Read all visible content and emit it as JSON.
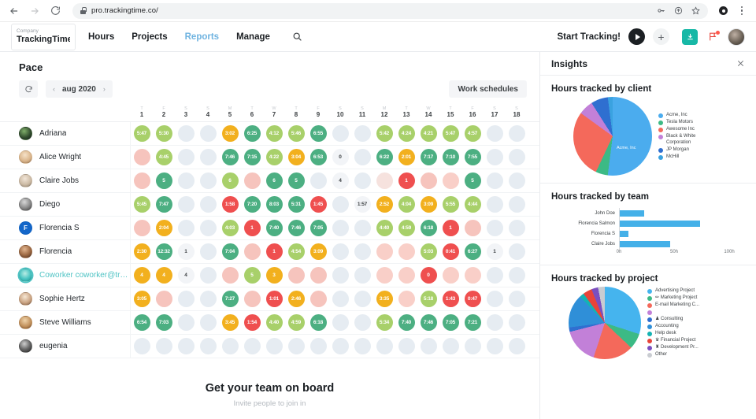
{
  "browser": {
    "url": "pro.trackingtime.co/",
    "back_icon": "back-arrow-icon",
    "forward_icon": "forward-arrow-icon",
    "reload_icon": "reload-icon"
  },
  "header": {
    "company_label": "Company",
    "company_name": "TrackingTime...",
    "nav": [
      {
        "label": "Hours",
        "active": false
      },
      {
        "label": "Projects",
        "active": false
      },
      {
        "label": "Reports",
        "active": true
      },
      {
        "label": "Manage",
        "active": false
      }
    ],
    "start_tracking": "Start Tracking!",
    "plus_label": "+"
  },
  "pace": {
    "title": "Pace",
    "month": "aug 2020",
    "prev": "‹",
    "next": "›",
    "work_schedules": "Work schedules"
  },
  "grid": {
    "days": [
      {
        "dow": "T",
        "num": "1"
      },
      {
        "dow": "F",
        "num": "2"
      },
      {
        "dow": "S",
        "num": "3"
      },
      {
        "dow": "S",
        "num": "4"
      },
      {
        "dow": "M",
        "num": "5"
      },
      {
        "dow": "T",
        "num": "6"
      },
      {
        "dow": "W",
        "num": "7"
      },
      {
        "dow": "T",
        "num": "8"
      },
      {
        "dow": "F",
        "num": "9"
      },
      {
        "dow": "S",
        "num": "10"
      },
      {
        "dow": "S",
        "num": "11"
      },
      {
        "dow": "M",
        "num": "12"
      },
      {
        "dow": "T",
        "num": "13"
      },
      {
        "dow": "W",
        "num": "14"
      },
      {
        "dow": "T",
        "num": "15"
      },
      {
        "dow": "F",
        "num": "16"
      },
      {
        "dow": "S",
        "num": "17"
      },
      {
        "dow": "S",
        "num": "18"
      }
    ],
    "rows": [
      {
        "name": "Adriana",
        "avatar": "photo-dark",
        "highlight": false,
        "cells": [
          {
            "v": "5:47",
            "c": "#a8d06a"
          },
          {
            "v": "5:30",
            "c": "#a8d06a"
          },
          {
            "v": "",
            "c": "empty"
          },
          {
            "v": "",
            "c": "empty"
          },
          {
            "v": "3:02",
            "c": "#f2b01e"
          },
          {
            "v": "6:25",
            "c": "#4caf82"
          },
          {
            "v": "4:12",
            "c": "#a8d06a"
          },
          {
            "v": "5:46",
            "c": "#a8d06a"
          },
          {
            "v": "6:55",
            "c": "#4caf82"
          },
          {
            "v": "",
            "c": "empty"
          },
          {
            "v": "",
            "c": "empty"
          },
          {
            "v": "5:42",
            "c": "#a8d06a"
          },
          {
            "v": "4:24",
            "c": "#a8d06a"
          },
          {
            "v": "4:21",
            "c": "#a8d06a"
          },
          {
            "v": "5:47",
            "c": "#a8d06a"
          },
          {
            "v": "4:57",
            "c": "#a8d06a"
          },
          {
            "v": "",
            "c": "empty"
          },
          {
            "v": "",
            "c": "empty"
          }
        ]
      },
      {
        "name": "Alice Wright",
        "avatar": "photo-light",
        "highlight": false,
        "cells": [
          {
            "v": "",
            "c": "#f6c4bd"
          },
          {
            "v": "4:45",
            "c": "#a8d06a"
          },
          {
            "v": "",
            "c": "empty"
          },
          {
            "v": "",
            "c": "empty"
          },
          {
            "v": "7:46",
            "c": "#4caf82"
          },
          {
            "v": "7:15",
            "c": "#4caf82"
          },
          {
            "v": "4:22",
            "c": "#a8d06a"
          },
          {
            "v": "3:04",
            "c": "#f2b01e"
          },
          {
            "v": "6:53",
            "c": "#4caf82"
          },
          {
            "v": "0",
            "c": "white"
          },
          {
            "v": "",
            "c": "empty"
          },
          {
            "v": "6:22",
            "c": "#4caf82"
          },
          {
            "v": "2:01",
            "c": "#f2b01e"
          },
          {
            "v": "7:17",
            "c": "#4caf82"
          },
          {
            "v": "7:10",
            "c": "#4caf82"
          },
          {
            "v": "7:55",
            "c": "#4caf82"
          },
          {
            "v": "",
            "c": "empty"
          },
          {
            "v": "",
            "c": "empty"
          }
        ]
      },
      {
        "name": "Claire Jobs",
        "avatar": "photo-light2",
        "highlight": false,
        "cells": [
          {
            "v": "",
            "c": "#f6c4bd"
          },
          {
            "v": "5",
            "c": "#4caf82"
          },
          {
            "v": "",
            "c": "empty"
          },
          {
            "v": "",
            "c": "empty"
          },
          {
            "v": "6",
            "c": "#a8d06a"
          },
          {
            "v": "",
            "c": "#f6c4bd"
          },
          {
            "v": "6",
            "c": "#4caf82"
          },
          {
            "v": "5",
            "c": "#4caf82"
          },
          {
            "v": "",
            "c": "empty"
          },
          {
            "v": "4",
            "c": "white"
          },
          {
            "v": "",
            "c": "empty"
          },
          {
            "v": "",
            "c": "#f6e2de"
          },
          {
            "v": "1",
            "c": "#ef4f4f"
          },
          {
            "v": "",
            "c": "#f6c4bd"
          },
          {
            "v": "",
            "c": "#f9cfc8"
          },
          {
            "v": "5",
            "c": "#4caf82"
          },
          {
            "v": "",
            "c": "empty"
          },
          {
            "v": "",
            "c": "empty"
          }
        ]
      },
      {
        "name": "Diego",
        "avatar": "photo-grey",
        "highlight": false,
        "cells": [
          {
            "v": "5:45",
            "c": "#a8d06a"
          },
          {
            "v": "7:47",
            "c": "#4caf82"
          },
          {
            "v": "",
            "c": "empty"
          },
          {
            "v": "",
            "c": "empty"
          },
          {
            "v": "1:58",
            "c": "#ef4f4f"
          },
          {
            "v": "7:20",
            "c": "#4caf82"
          },
          {
            "v": "8:03",
            "c": "#4caf82"
          },
          {
            "v": "5:31",
            "c": "#4caf82"
          },
          {
            "v": "1:45",
            "c": "#ef4f4f"
          },
          {
            "v": "",
            "c": "empty"
          },
          {
            "v": "1:57",
            "c": "white"
          },
          {
            "v": "2:52",
            "c": "#f2b01e"
          },
          {
            "v": "4:04",
            "c": "#a8d06a"
          },
          {
            "v": "3:09",
            "c": "#f2b01e"
          },
          {
            "v": "5:55",
            "c": "#a8d06a"
          },
          {
            "v": "4:44",
            "c": "#a8d06a"
          },
          {
            "v": "",
            "c": "empty"
          },
          {
            "v": "",
            "c": "empty"
          }
        ]
      },
      {
        "name": "Florencia S",
        "avatar": "initial-F",
        "highlight": false,
        "cells": [
          {
            "v": "",
            "c": "#f6c4bd"
          },
          {
            "v": "2:04",
            "c": "#f2b01e"
          },
          {
            "v": "",
            "c": "empty"
          },
          {
            "v": "",
            "c": "empty"
          },
          {
            "v": "4:03",
            "c": "#a8d06a"
          },
          {
            "v": "1",
            "c": "#ef4f4f"
          },
          {
            "v": "7:40",
            "c": "#4caf82"
          },
          {
            "v": "7:46",
            "c": "#4caf82"
          },
          {
            "v": "7:05",
            "c": "#4caf82"
          },
          {
            "v": "",
            "c": "empty"
          },
          {
            "v": "",
            "c": "empty"
          },
          {
            "v": "4:40",
            "c": "#a8d06a"
          },
          {
            "v": "4:59",
            "c": "#a8d06a"
          },
          {
            "v": "6:18",
            "c": "#4caf82"
          },
          {
            "v": "1",
            "c": "#ef4f4f"
          },
          {
            "v": "",
            "c": "#f6c4bd"
          },
          {
            "v": "",
            "c": "empty"
          },
          {
            "v": "",
            "c": "empty"
          }
        ]
      },
      {
        "name": "Florencia",
        "avatar": "photo-brown",
        "highlight": false,
        "cells": [
          {
            "v": "2:30",
            "c": "#f2b01e"
          },
          {
            "v": "12:32",
            "c": "#4caf82"
          },
          {
            "v": "1",
            "c": "white"
          },
          {
            "v": "",
            "c": "empty"
          },
          {
            "v": "7:04",
            "c": "#4caf82"
          },
          {
            "v": "",
            "c": "#f6c4bd"
          },
          {
            "v": "1",
            "c": "#ef4f4f"
          },
          {
            "v": "4:54",
            "c": "#a8d06a"
          },
          {
            "v": "3:09",
            "c": "#f2b01e"
          },
          {
            "v": "",
            "c": "empty"
          },
          {
            "v": "",
            "c": "empty"
          },
          {
            "v": "",
            "c": "#f9cfc8"
          },
          {
            "v": "",
            "c": "#f9cfc8"
          },
          {
            "v": "5:03",
            "c": "#a8d06a"
          },
          {
            "v": "0:41",
            "c": "#ef4f4f"
          },
          {
            "v": "6:27",
            "c": "#4caf82"
          },
          {
            "v": "1",
            "c": "white"
          },
          {
            "v": "",
            "c": "empty"
          }
        ]
      },
      {
        "name": "Coworker coworker@trac...",
        "avatar": "photo-teal",
        "highlight": true,
        "cells": [
          {
            "v": "4",
            "c": "#f2b01e"
          },
          {
            "v": "4",
            "c": "#f2b01e"
          },
          {
            "v": "4",
            "c": "white"
          },
          {
            "v": "",
            "c": "empty"
          },
          {
            "v": "",
            "c": "#f6c4bd"
          },
          {
            "v": "5",
            "c": "#a8d06a"
          },
          {
            "v": "3",
            "c": "#f2b01e"
          },
          {
            "v": "",
            "c": "#f6c4bd"
          },
          {
            "v": "",
            "c": "#f6c4bd"
          },
          {
            "v": "",
            "c": "empty"
          },
          {
            "v": "",
            "c": "empty"
          },
          {
            "v": "",
            "c": "#f9cfc8"
          },
          {
            "v": "",
            "c": "#f9cfc8"
          },
          {
            "v": "0",
            "c": "#ef4f4f"
          },
          {
            "v": "",
            "c": "#f9cfc8"
          },
          {
            "v": "",
            "c": "#f9cfc8"
          },
          {
            "v": "",
            "c": "empty"
          },
          {
            "v": "",
            "c": "empty"
          }
        ]
      },
      {
        "name": "Sophie Hertz",
        "avatar": "photo-light3",
        "highlight": false,
        "cells": [
          {
            "v": "3:05",
            "c": "#f2b01e"
          },
          {
            "v": "",
            "c": "#f6c4bd"
          },
          {
            "v": "",
            "c": "empty"
          },
          {
            "v": "",
            "c": "empty"
          },
          {
            "v": "7:27",
            "c": "#4caf82"
          },
          {
            "v": "",
            "c": "#f6c4bd"
          },
          {
            "v": "1:01",
            "c": "#ef4f4f"
          },
          {
            "v": "2:46",
            "c": "#f2b01e"
          },
          {
            "v": "",
            "c": "#f6c4bd"
          },
          {
            "v": "",
            "c": "empty"
          },
          {
            "v": "",
            "c": "empty"
          },
          {
            "v": "3:35",
            "c": "#f2b01e"
          },
          {
            "v": "",
            "c": "#f9cfc8"
          },
          {
            "v": "5:18",
            "c": "#a8d06a"
          },
          {
            "v": "1:43",
            "c": "#ef4f4f"
          },
          {
            "v": "0:47",
            "c": "#ef4f4f"
          },
          {
            "v": "",
            "c": "empty"
          },
          {
            "v": "",
            "c": "empty"
          }
        ]
      },
      {
        "name": "Steve Williams",
        "avatar": "photo-tan",
        "highlight": false,
        "cells": [
          {
            "v": "6:54",
            "c": "#4caf82"
          },
          {
            "v": "7:03",
            "c": "#4caf82"
          },
          {
            "v": "",
            "c": "empty"
          },
          {
            "v": "",
            "c": "empty"
          },
          {
            "v": "3:45",
            "c": "#f2b01e"
          },
          {
            "v": "1:54",
            "c": "#ef4f4f"
          },
          {
            "v": "4:40",
            "c": "#a8d06a"
          },
          {
            "v": "4:59",
            "c": "#a8d06a"
          },
          {
            "v": "6:18",
            "c": "#4caf82"
          },
          {
            "v": "",
            "c": "empty"
          },
          {
            "v": "",
            "c": "empty"
          },
          {
            "v": "5:34",
            "c": "#a8d06a"
          },
          {
            "v": "7:40",
            "c": "#4caf82"
          },
          {
            "v": "7:46",
            "c": "#4caf82"
          },
          {
            "v": "7:05",
            "c": "#4caf82"
          },
          {
            "v": "7:21",
            "c": "#4caf82"
          },
          {
            "v": "",
            "c": "empty"
          },
          {
            "v": "",
            "c": "empty"
          }
        ]
      },
      {
        "name": "eugenia",
        "avatar": "photo-dark2",
        "highlight": false,
        "cells": [
          {
            "v": "",
            "c": "empty"
          },
          {
            "v": "",
            "c": "empty"
          },
          {
            "v": "",
            "c": "empty"
          },
          {
            "v": "",
            "c": "empty"
          },
          {
            "v": "",
            "c": "empty"
          },
          {
            "v": "",
            "c": "empty"
          },
          {
            "v": "",
            "c": "empty"
          },
          {
            "v": "",
            "c": "empty"
          },
          {
            "v": "",
            "c": "empty"
          },
          {
            "v": "",
            "c": "empty"
          },
          {
            "v": "",
            "c": "empty"
          },
          {
            "v": "",
            "c": "empty"
          },
          {
            "v": "",
            "c": "empty"
          },
          {
            "v": "",
            "c": "empty"
          },
          {
            "v": "",
            "c": "empty"
          },
          {
            "v": "",
            "c": "empty"
          },
          {
            "v": "",
            "c": "empty"
          },
          {
            "v": "",
            "c": "empty"
          }
        ]
      }
    ]
  },
  "cta": {
    "title": "Get your team on board",
    "subtitle": "Invite people to join in"
  },
  "insights": {
    "title": "Insights",
    "close_icon": "close-icon",
    "sections": [
      {
        "title": "Hours tracked by client"
      },
      {
        "title": "Hours tracked by team"
      },
      {
        "title": "Hours tracked by project"
      }
    ]
  },
  "chart_data": [
    {
      "type": "pie",
      "title": "Hours tracked by client",
      "categories": [
        "Acme, Inc",
        "Tesla Motors",
        "Awesome Inc",
        "Black & White Corporation",
        "JP Morgan",
        "McHill"
      ],
      "values": [
        52,
        5,
        28,
        6,
        7,
        2
      ],
      "colors": [
        "#4bacee",
        "#3cba85",
        "#f4695b",
        "#c280d8",
        "#2f6fd0",
        "#3aa2e0"
      ],
      "annotations": [
        "Acme, Inc"
      ],
      "legend_position": "right"
    },
    {
      "type": "bar",
      "orientation": "horizontal",
      "title": "Hours tracked by team",
      "categories": [
        "John Doe",
        "Florencia Salmon",
        "Florencia S",
        "Claire Jobs"
      ],
      "values": [
        22,
        73,
        8,
        46
      ],
      "xlabel": "",
      "ylabel": "",
      "xlim": [
        0,
        110
      ],
      "xticks": [
        "0h",
        "50h",
        "100h"
      ],
      "xtick_values": [
        0,
        50,
        100
      ],
      "color": "#44b0e8",
      "grid": false
    },
    {
      "type": "pie",
      "title": "Hours tracked by project",
      "categories": [
        "Advertising Project",
        "✏ Marketing Project",
        "E-mail Marketing C...",
        "",
        "♟ Consulting",
        "Accounting",
        "Help desk",
        "♛ Financial Project",
        "♜ Development Pr...",
        "Other"
      ],
      "values": [
        30,
        7,
        18,
        16,
        2,
        15,
        2,
        4,
        3,
        3
      ],
      "colors": [
        "#45b4ee",
        "#3cba85",
        "#f4695b",
        "#c280d8",
        "#2f6fd0",
        "#2f8fd8",
        "#14b3b3",
        "#e8443a",
        "#7a4fc0",
        "#c9ccd1"
      ],
      "legend_position": "right"
    }
  ]
}
